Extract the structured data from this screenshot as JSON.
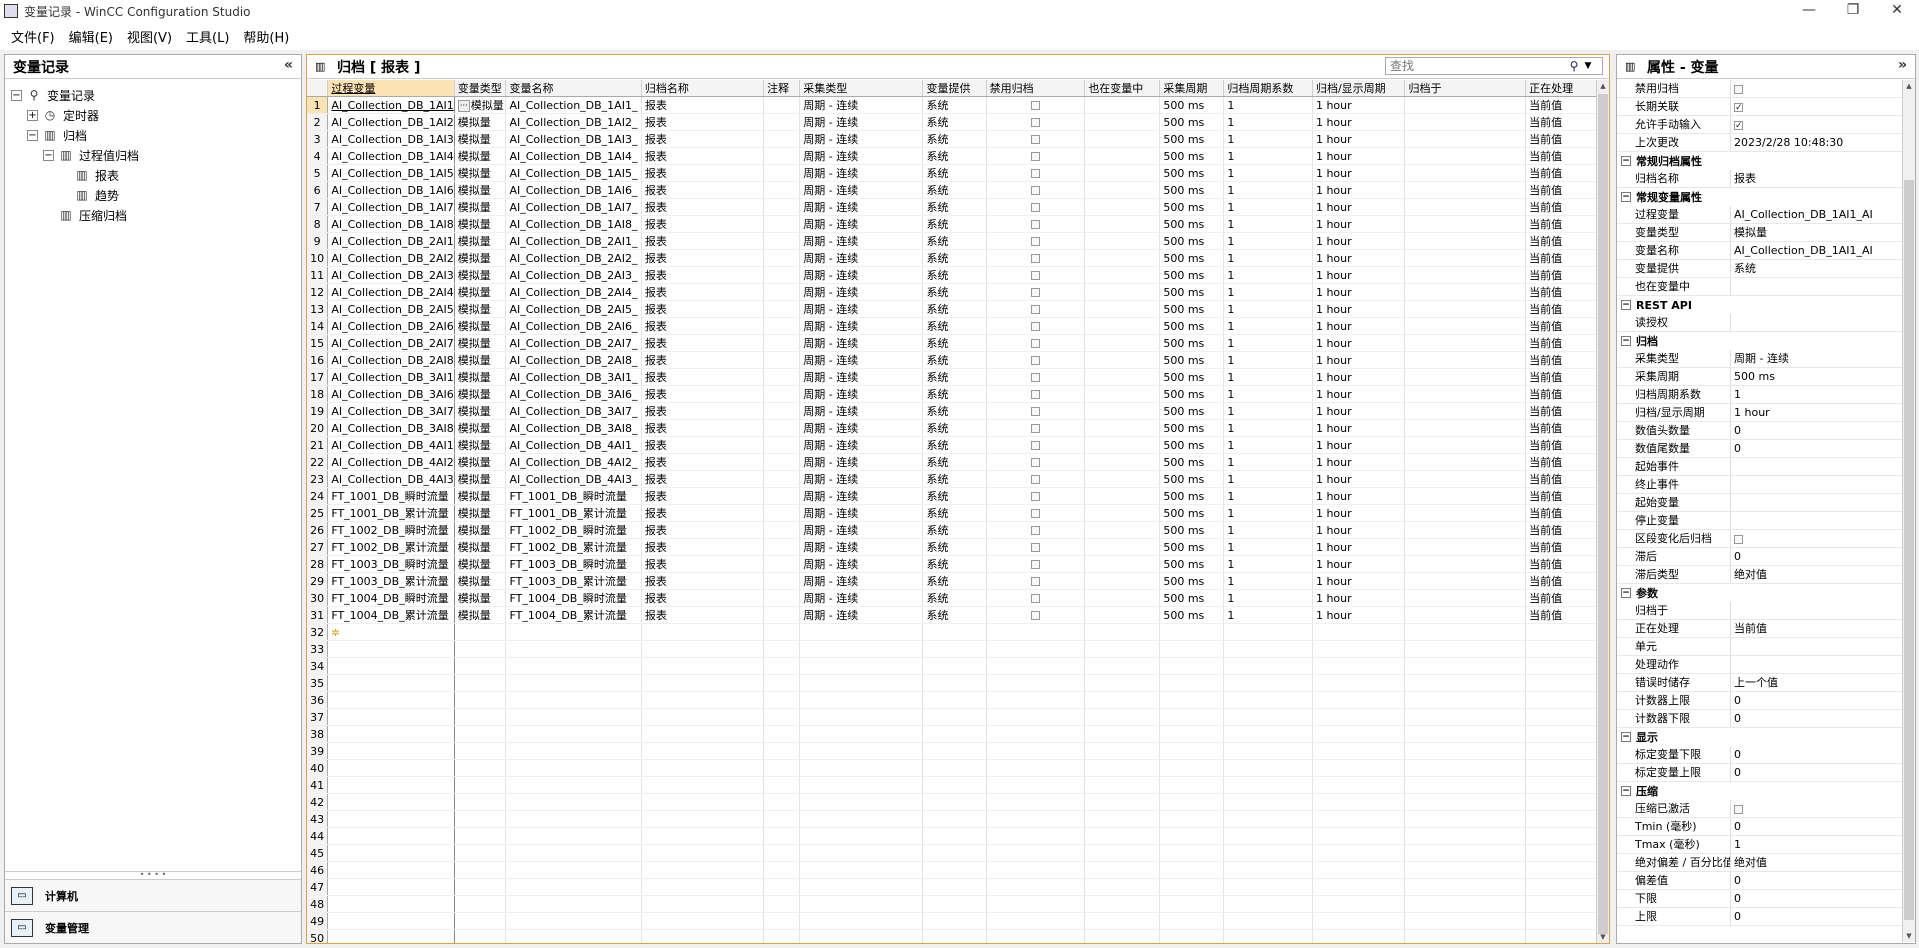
{
  "window": {
    "title": "变量记录 - WinCC Configuration Studio",
    "minimize": "—",
    "restore": "❐",
    "close": "✕"
  },
  "menu": [
    "文件(F)",
    "编辑(E)",
    "视图(V)",
    "工具(L)",
    "帮助(H)"
  ],
  "left_panel": {
    "title": "变量记录",
    "collapse_glyph": "«",
    "tree": [
      {
        "label": "变量记录",
        "level": 0,
        "exp": "-",
        "icon": "tag-logging-icon"
      },
      {
        "label": "定时器",
        "level": 1,
        "exp": "+",
        "icon": "timer-icon"
      },
      {
        "label": "归档",
        "level": 1,
        "exp": "-",
        "icon": "archive-icon"
      },
      {
        "label": "过程值归档",
        "level": 2,
        "exp": "-",
        "icon": "archive-icon"
      },
      {
        "label": "报表",
        "level": 3,
        "exp": "",
        "icon": "archive-icon"
      },
      {
        "label": "趋势",
        "level": 3,
        "exp": "",
        "icon": "archive-icon"
      },
      {
        "label": "压缩归档",
        "level": 2,
        "exp": "",
        "icon": "archive-icon"
      }
    ],
    "nav": [
      {
        "label": "计算机",
        "icon": "computer-icon"
      },
      {
        "label": "变量管理",
        "icon": "tag-management-icon"
      }
    ]
  },
  "center_panel": {
    "title": "归档 [ 报表 ]",
    "search_placeholder": "查找",
    "columns": [
      "过程变量",
      "变量类型",
      "变量名称",
      "归档名称",
      "注释",
      "采集类型",
      "变量提供",
      "禁用归档",
      "也在变量中",
      "采集周期",
      "归档周期系数",
      "归档/显示周期",
      "归档于",
      "正在处理"
    ],
    "rows": [
      {
        "n": "1",
        "pv": "AI_Collection_DB_1AI1",
        "type": "模拟量",
        "name": "AI_Collection_DB_1AI1_",
        "arch": "报表",
        "acq": "周期 - 连续",
        "prov": "系统",
        "cycle": "500 ms",
        "factor": "1",
        "disp": "1 hour",
        "proc": "当前值"
      },
      {
        "n": "2",
        "pv": "AI_Collection_DB_1AI2",
        "type": "模拟量",
        "name": "AI_Collection_DB_1AI2_",
        "arch": "报表",
        "acq": "周期 - 连续",
        "prov": "系统",
        "cycle": "500 ms",
        "factor": "1",
        "disp": "1 hour",
        "proc": "当前值"
      },
      {
        "n": "3",
        "pv": "AI_Collection_DB_1AI3",
        "type": "模拟量",
        "name": "AI_Collection_DB_1AI3_",
        "arch": "报表",
        "acq": "周期 - 连续",
        "prov": "系统",
        "cycle": "500 ms",
        "factor": "1",
        "disp": "1 hour",
        "proc": "当前值"
      },
      {
        "n": "4",
        "pv": "AI_Collection_DB_1AI4",
        "type": "模拟量",
        "name": "AI_Collection_DB_1AI4_",
        "arch": "报表",
        "acq": "周期 - 连续",
        "prov": "系统",
        "cycle": "500 ms",
        "factor": "1",
        "disp": "1 hour",
        "proc": "当前值"
      },
      {
        "n": "5",
        "pv": "AI_Collection_DB_1AI5",
        "type": "模拟量",
        "name": "AI_Collection_DB_1AI5_",
        "arch": "报表",
        "acq": "周期 - 连续",
        "prov": "系统",
        "cycle": "500 ms",
        "factor": "1",
        "disp": "1 hour",
        "proc": "当前值"
      },
      {
        "n": "6",
        "pv": "AI_Collection_DB_1AI6",
        "type": "模拟量",
        "name": "AI_Collection_DB_1AI6_",
        "arch": "报表",
        "acq": "周期 - 连续",
        "prov": "系统",
        "cycle": "500 ms",
        "factor": "1",
        "disp": "1 hour",
        "proc": "当前值"
      },
      {
        "n": "7",
        "pv": "AI_Collection_DB_1AI7",
        "type": "模拟量",
        "name": "AI_Collection_DB_1AI7_",
        "arch": "报表",
        "acq": "周期 - 连续",
        "prov": "系统",
        "cycle": "500 ms",
        "factor": "1",
        "disp": "1 hour",
        "proc": "当前值"
      },
      {
        "n": "8",
        "pv": "AI_Collection_DB_1AI8",
        "type": "模拟量",
        "name": "AI_Collection_DB_1AI8_",
        "arch": "报表",
        "acq": "周期 - 连续",
        "prov": "系统",
        "cycle": "500 ms",
        "factor": "1",
        "disp": "1 hour",
        "proc": "当前值"
      },
      {
        "n": "9",
        "pv": "AI_Collection_DB_2AI1",
        "type": "模拟量",
        "name": "AI_Collection_DB_2AI1_",
        "arch": "报表",
        "acq": "周期 - 连续",
        "prov": "系统",
        "cycle": "500 ms",
        "factor": "1",
        "disp": "1 hour",
        "proc": "当前值"
      },
      {
        "n": "10",
        "pv": "AI_Collection_DB_2AI2",
        "type": "模拟量",
        "name": "AI_Collection_DB_2AI2_",
        "arch": "报表",
        "acq": "周期 - 连续",
        "prov": "系统",
        "cycle": "500 ms",
        "factor": "1",
        "disp": "1 hour",
        "proc": "当前值"
      },
      {
        "n": "11",
        "pv": "AI_Collection_DB_2AI3",
        "type": "模拟量",
        "name": "AI_Collection_DB_2AI3_",
        "arch": "报表",
        "acq": "周期 - 连续",
        "prov": "系统",
        "cycle": "500 ms",
        "factor": "1",
        "disp": "1 hour",
        "proc": "当前值"
      },
      {
        "n": "12",
        "pv": "AI_Collection_DB_2AI4",
        "type": "模拟量",
        "name": "AI_Collection_DB_2AI4_",
        "arch": "报表",
        "acq": "周期 - 连续",
        "prov": "系统",
        "cycle": "500 ms",
        "factor": "1",
        "disp": "1 hour",
        "proc": "当前值"
      },
      {
        "n": "13",
        "pv": "AI_Collection_DB_2AI5",
        "type": "模拟量",
        "name": "AI_Collection_DB_2AI5_",
        "arch": "报表",
        "acq": "周期 - 连续",
        "prov": "系统",
        "cycle": "500 ms",
        "factor": "1",
        "disp": "1 hour",
        "proc": "当前值"
      },
      {
        "n": "14",
        "pv": "AI_Collection_DB_2AI6",
        "type": "模拟量",
        "name": "AI_Collection_DB_2AI6_",
        "arch": "报表",
        "acq": "周期 - 连续",
        "prov": "系统",
        "cycle": "500 ms",
        "factor": "1",
        "disp": "1 hour",
        "proc": "当前值"
      },
      {
        "n": "15",
        "pv": "AI_Collection_DB_2AI7",
        "type": "模拟量",
        "name": "AI_Collection_DB_2AI7_",
        "arch": "报表",
        "acq": "周期 - 连续",
        "prov": "系统",
        "cycle": "500 ms",
        "factor": "1",
        "disp": "1 hour",
        "proc": "当前值"
      },
      {
        "n": "16",
        "pv": "AI_Collection_DB_2AI8",
        "type": "模拟量",
        "name": "AI_Collection_DB_2AI8_",
        "arch": "报表",
        "acq": "周期 - 连续",
        "prov": "系统",
        "cycle": "500 ms",
        "factor": "1",
        "disp": "1 hour",
        "proc": "当前值"
      },
      {
        "n": "17",
        "pv": "AI_Collection_DB_3AI1",
        "type": "模拟量",
        "name": "AI_Collection_DB_3AI1_",
        "arch": "报表",
        "acq": "周期 - 连续",
        "prov": "系统",
        "cycle": "500 ms",
        "factor": "1",
        "disp": "1 hour",
        "proc": "当前值"
      },
      {
        "n": "18",
        "pv": "AI_Collection_DB_3AI6",
        "type": "模拟量",
        "name": "AI_Collection_DB_3AI6_",
        "arch": "报表",
        "acq": "周期 - 连续",
        "prov": "系统",
        "cycle": "500 ms",
        "factor": "1",
        "disp": "1 hour",
        "proc": "当前值"
      },
      {
        "n": "19",
        "pv": "AI_Collection_DB_3AI7",
        "type": "模拟量",
        "name": "AI_Collection_DB_3AI7_",
        "arch": "报表",
        "acq": "周期 - 连续",
        "prov": "系统",
        "cycle": "500 ms",
        "factor": "1",
        "disp": "1 hour",
        "proc": "当前值"
      },
      {
        "n": "20",
        "pv": "AI_Collection_DB_3AI8",
        "type": "模拟量",
        "name": "AI_Collection_DB_3AI8_",
        "arch": "报表",
        "acq": "周期 - 连续",
        "prov": "系统",
        "cycle": "500 ms",
        "factor": "1",
        "disp": "1 hour",
        "proc": "当前值"
      },
      {
        "n": "21",
        "pv": "AI_Collection_DB_4AI1",
        "type": "模拟量",
        "name": "AI_Collection_DB_4AI1_",
        "arch": "报表",
        "acq": "周期 - 连续",
        "prov": "系统",
        "cycle": "500 ms",
        "factor": "1",
        "disp": "1 hour",
        "proc": "当前值"
      },
      {
        "n": "22",
        "pv": "AI_Collection_DB_4AI2",
        "type": "模拟量",
        "name": "AI_Collection_DB_4AI2_",
        "arch": "报表",
        "acq": "周期 - 连续",
        "prov": "系统",
        "cycle": "500 ms",
        "factor": "1",
        "disp": "1 hour",
        "proc": "当前值"
      },
      {
        "n": "23",
        "pv": "AI_Collection_DB_4AI3",
        "type": "模拟量",
        "name": "AI_Collection_DB_4AI3_",
        "arch": "报表",
        "acq": "周期 - 连续",
        "prov": "系统",
        "cycle": "500 ms",
        "factor": "1",
        "disp": "1 hour",
        "proc": "当前值"
      },
      {
        "n": "24",
        "pv": "FT_1001_DB_瞬时流量",
        "type": "模拟量",
        "name": "FT_1001_DB_瞬时流量",
        "arch": "报表",
        "acq": "周期 - 连续",
        "prov": "系统",
        "cycle": "500 ms",
        "factor": "1",
        "disp": "1 hour",
        "proc": "当前值"
      },
      {
        "n": "25",
        "pv": "FT_1001_DB_累计流量",
        "type": "模拟量",
        "name": "FT_1001_DB_累计流量",
        "arch": "报表",
        "acq": "周期 - 连续",
        "prov": "系统",
        "cycle": "500 ms",
        "factor": "1",
        "disp": "1 hour",
        "proc": "当前值"
      },
      {
        "n": "26",
        "pv": "FT_1002_DB_瞬时流量",
        "type": "模拟量",
        "name": "FT_1002_DB_瞬时流量",
        "arch": "报表",
        "acq": "周期 - 连续",
        "prov": "系统",
        "cycle": "500 ms",
        "factor": "1",
        "disp": "1 hour",
        "proc": "当前值"
      },
      {
        "n": "27",
        "pv": "FT_1002_DB_累计流量",
        "type": "模拟量",
        "name": "FT_1002_DB_累计流量",
        "arch": "报表",
        "acq": "周期 - 连续",
        "prov": "系统",
        "cycle": "500 ms",
        "factor": "1",
        "disp": "1 hour",
        "proc": "当前值"
      },
      {
        "n": "28",
        "pv": "FT_1003_DB_瞬时流量",
        "type": "模拟量",
        "name": "FT_1003_DB_瞬时流量",
        "arch": "报表",
        "acq": "周期 - 连续",
        "prov": "系统",
        "cycle": "500 ms",
        "factor": "1",
        "disp": "1 hour",
        "proc": "当前值"
      },
      {
        "n": "29",
        "pv": "FT_1003_DB_累计流量",
        "type": "模拟量",
        "name": "FT_1003_DB_累计流量",
        "arch": "报表",
        "acq": "周期 - 连续",
        "prov": "系统",
        "cycle": "500 ms",
        "factor": "1",
        "disp": "1 hour",
        "proc": "当前值"
      },
      {
        "n": "30",
        "pv": "FT_1004_DB_瞬时流量",
        "type": "模拟量",
        "name": "FT_1004_DB_瞬时流量",
        "arch": "报表",
        "acq": "周期 - 连续",
        "prov": "系统",
        "cycle": "500 ms",
        "factor": "1",
        "disp": "1 hour",
        "proc": "当前值"
      },
      {
        "n": "31",
        "pv": "FT_1004_DB_累计流量",
        "type": "模拟量",
        "name": "FT_1004_DB_累计流量",
        "arch": "报表",
        "acq": "周期 - 连续",
        "prov": "系统",
        "cycle": "500 ms",
        "factor": "1",
        "disp": "1 hour",
        "proc": "当前值"
      }
    ],
    "new_row_number": "32",
    "new_row_glyph": "✲",
    "empty_row_numbers": [
      "33",
      "34",
      "35",
      "36",
      "37",
      "38",
      "39",
      "40",
      "41",
      "42",
      "43",
      "44",
      "45",
      "46",
      "47",
      "48",
      "49",
      "50"
    ]
  },
  "right_panel": {
    "title": "属性 - 变量",
    "collapse_glyph": "»",
    "items": [
      {
        "kind": "row",
        "name": "禁用归档",
        "checkbox": false
      },
      {
        "kind": "row",
        "name": "长期关联",
        "checkbox": true
      },
      {
        "kind": "row",
        "name": "允许手动输入",
        "checkbox": true
      },
      {
        "kind": "row",
        "name": "上次更改",
        "value": "2023/2/28 10:48:30"
      },
      {
        "kind": "cat",
        "name": "常规归档属性"
      },
      {
        "kind": "row",
        "name": "归档名称",
        "value": "报表"
      },
      {
        "kind": "cat",
        "name": "常规变量属性"
      },
      {
        "kind": "row",
        "name": "过程变量",
        "value": "AI_Collection_DB_1AI1_AI"
      },
      {
        "kind": "row",
        "name": "变量类型",
        "value": "模拟量"
      },
      {
        "kind": "row",
        "name": "变量名称",
        "value": "AI_Collection_DB_1AI1_AI"
      },
      {
        "kind": "row",
        "name": "变量提供",
        "value": "系统"
      },
      {
        "kind": "row",
        "name": "也在变量中",
        "value": ""
      },
      {
        "kind": "cat",
        "name": "REST API"
      },
      {
        "kind": "row",
        "name": "读授权",
        "value": ""
      },
      {
        "kind": "cat",
        "name": "归档"
      },
      {
        "kind": "row",
        "name": "采集类型",
        "value": "周期 - 连续"
      },
      {
        "kind": "row",
        "name": "采集周期",
        "value": "500 ms"
      },
      {
        "kind": "row",
        "name": "归档周期系数",
        "value": "1"
      },
      {
        "kind": "row",
        "name": "归档/显示周期",
        "value": "1 hour"
      },
      {
        "kind": "row",
        "name": "数值头数量",
        "value": "0"
      },
      {
        "kind": "row",
        "name": "数值尾数量",
        "value": "0"
      },
      {
        "kind": "row",
        "name": "起始事件",
        "value": ""
      },
      {
        "kind": "row",
        "name": "终止事件",
        "value": ""
      },
      {
        "kind": "row",
        "name": "起始变量",
        "value": ""
      },
      {
        "kind": "row",
        "name": "停止变量",
        "value": ""
      },
      {
        "kind": "row",
        "name": "区段变化后归档",
        "checkbox": false
      },
      {
        "kind": "row",
        "name": "滞后",
        "value": "0"
      },
      {
        "kind": "row",
        "name": "滞后类型",
        "value": "绝对值"
      },
      {
        "kind": "cat",
        "name": "参数"
      },
      {
        "kind": "row",
        "name": "归档于",
        "value": ""
      },
      {
        "kind": "row",
        "name": "正在处理",
        "value": "当前值"
      },
      {
        "kind": "row",
        "name": "单元",
        "value": ""
      },
      {
        "kind": "row",
        "name": "处理动作",
        "value": ""
      },
      {
        "kind": "row",
        "name": "错误时储存",
        "value": "上一个值"
      },
      {
        "kind": "row",
        "name": "计数器上限",
        "value": "0"
      },
      {
        "kind": "row",
        "name": "计数器下限",
        "value": "0"
      },
      {
        "kind": "cat",
        "name": "显示"
      },
      {
        "kind": "row",
        "name": "标定变量下限",
        "value": "0"
      },
      {
        "kind": "row",
        "name": "标定变量上限",
        "value": "0"
      },
      {
        "kind": "cat",
        "name": "压缩"
      },
      {
        "kind": "row",
        "name": "压缩已激活",
        "checkbox": false
      },
      {
        "kind": "row",
        "name": "Tmin (毫秒)",
        "value": "0"
      },
      {
        "kind": "row",
        "name": "Tmax (毫秒)",
        "value": "1"
      },
      {
        "kind": "row",
        "name": "绝对偏差 / 百分比值",
        "value": "绝对值"
      },
      {
        "kind": "row",
        "name": "偏差值",
        "value": "0"
      },
      {
        "kind": "row",
        "name": "下限",
        "value": "0"
      },
      {
        "kind": "row",
        "name": "上限",
        "value": "0"
      }
    ]
  }
}
